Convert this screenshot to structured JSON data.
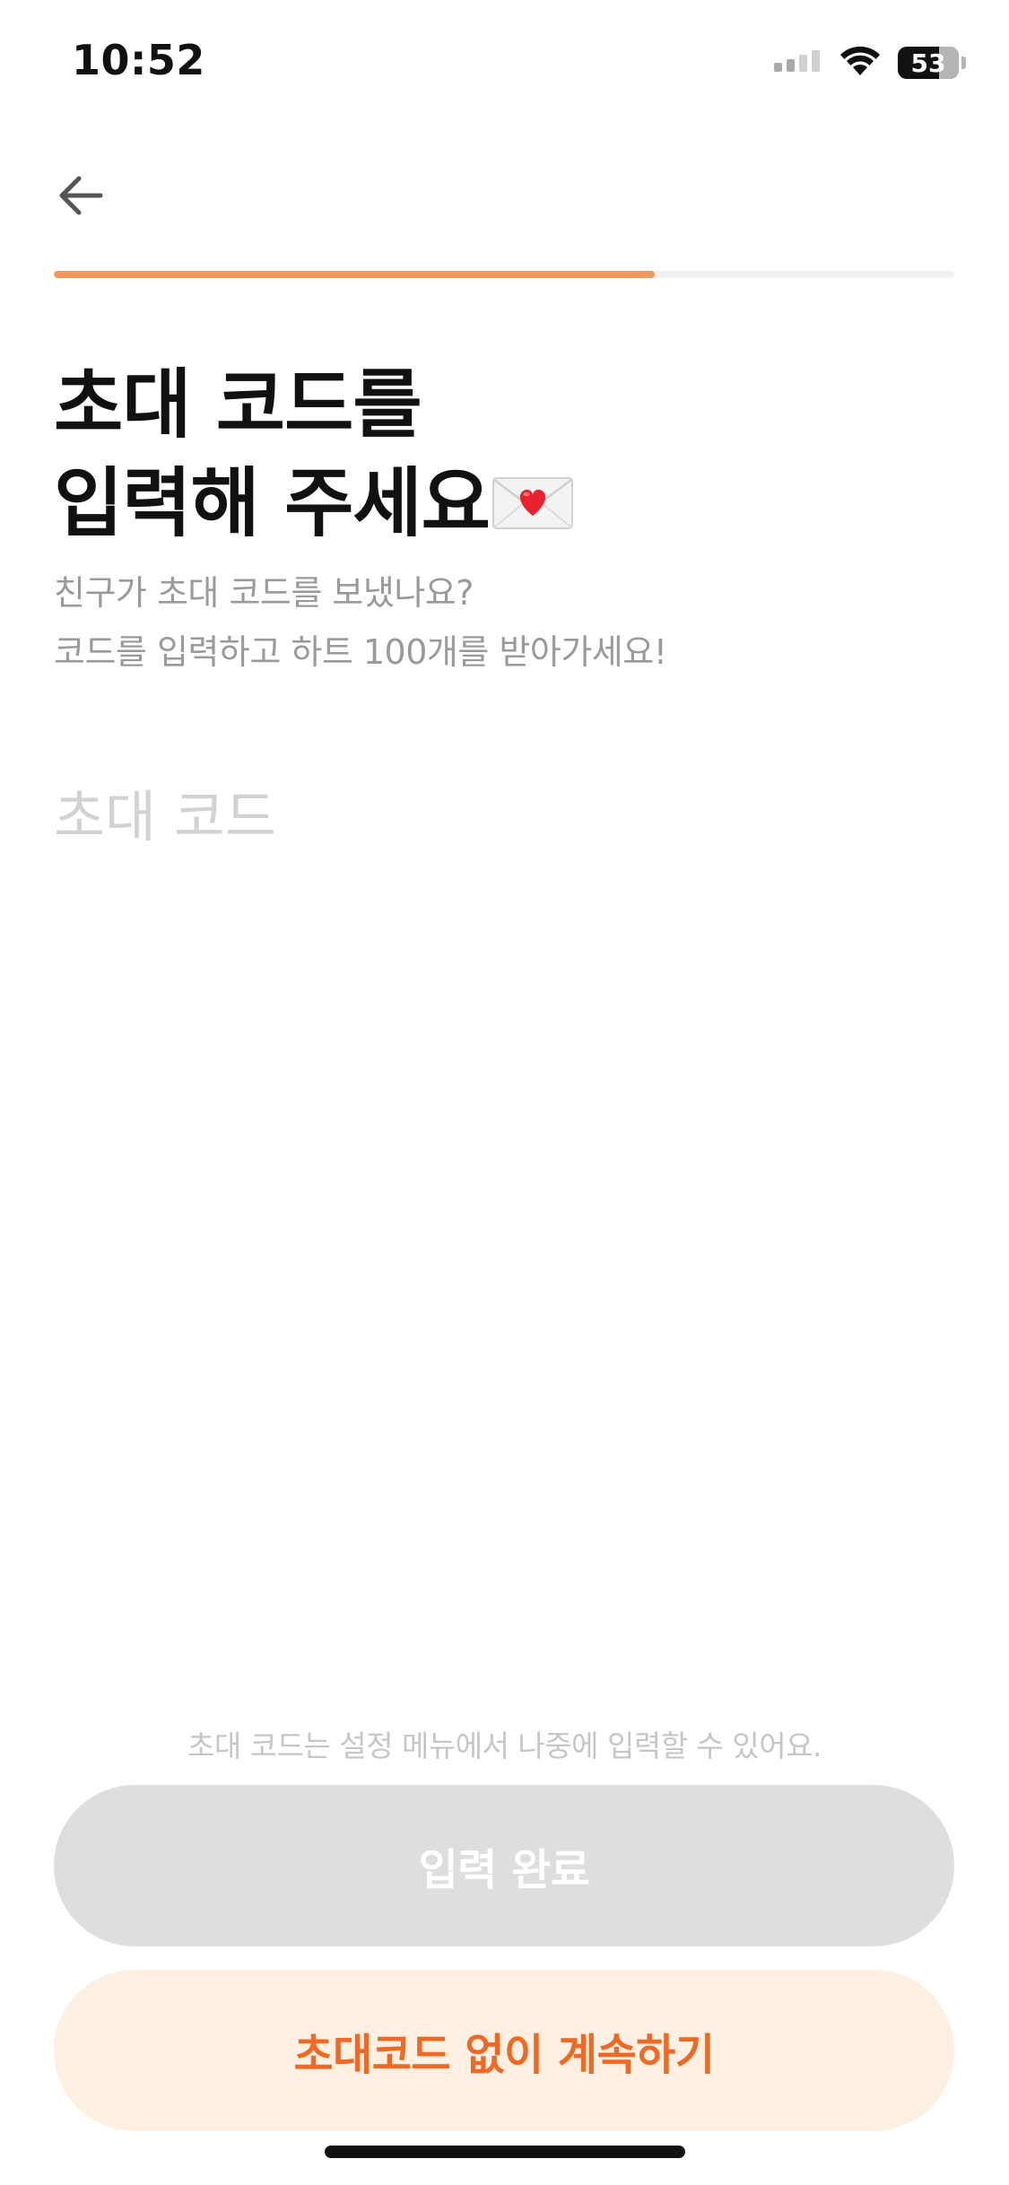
{
  "status_bar": {
    "time": "10:52",
    "battery_level": "53",
    "signal_icon": "cellular-signal-icon",
    "wifi_icon": "wifi-icon",
    "battery_icon": "battery-icon"
  },
  "nav": {
    "back_icon": "arrow-left-icon"
  },
  "progress": {
    "fraction": 0.667,
    "fill_color": "#f0995a",
    "track_color": "#f1f1f1"
  },
  "header": {
    "title_line1": "초대 코드를",
    "title_line2": "입력해 주세요",
    "title_icon": "love-letter-icon"
  },
  "subtitle": {
    "line1": "친구가 초대 코드를 보냈나요?",
    "line2": "코드를 입력하고 하트 100개를 받아가세요!"
  },
  "invite_input": {
    "value": "",
    "placeholder": "초대 코드"
  },
  "footer": {
    "hint": "초대 코드는 설정 메뉴에서 나중에 입력할 수 있어요.",
    "submit_label": "입력 완료",
    "skip_label": "초대코드 없이 계속하기"
  },
  "colors": {
    "accent": "#ec6a25",
    "skip_bg": "#fdf0e2",
    "disabled_bg": "#dedede"
  }
}
